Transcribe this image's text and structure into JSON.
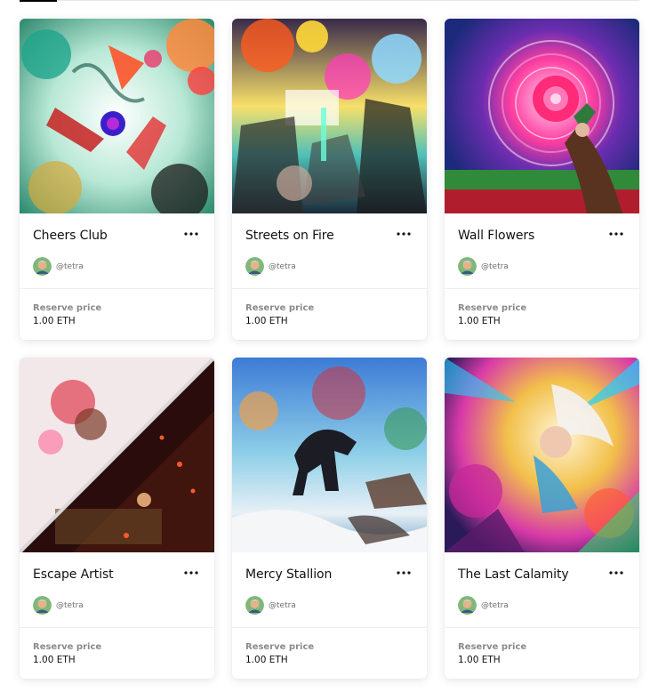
{
  "cards": [
    {
      "title": "Cheers Club",
      "creator": "@tetra",
      "price_label": "Reserve price",
      "price": "1.00 ETH"
    },
    {
      "title": "Streets on Fire",
      "creator": "@tetra",
      "price_label": "Reserve price",
      "price": "1.00 ETH"
    },
    {
      "title": "Wall Flowers",
      "creator": "@tetra",
      "price_label": "Reserve price",
      "price": "1.00 ETH"
    },
    {
      "title": "Escape Artist",
      "creator": "@tetra",
      "price_label": "Reserve price",
      "price": "1.00 ETH"
    },
    {
      "title": "Mercy Stallion",
      "creator": "@tetra",
      "price_label": "Reserve price",
      "price": "1.00 ETH"
    },
    {
      "title": "The Last Calamity",
      "creator": "@tetra",
      "price_label": "Reserve price",
      "price": "1.00 ETH"
    }
  ],
  "icons": {
    "more": "more-horizontal-icon",
    "avatar": "creator-avatar"
  },
  "colors": {
    "text": "#111111",
    "muted": "#8a8a8a",
    "handle": "#6e6e6e",
    "active_tab": "#000000"
  }
}
